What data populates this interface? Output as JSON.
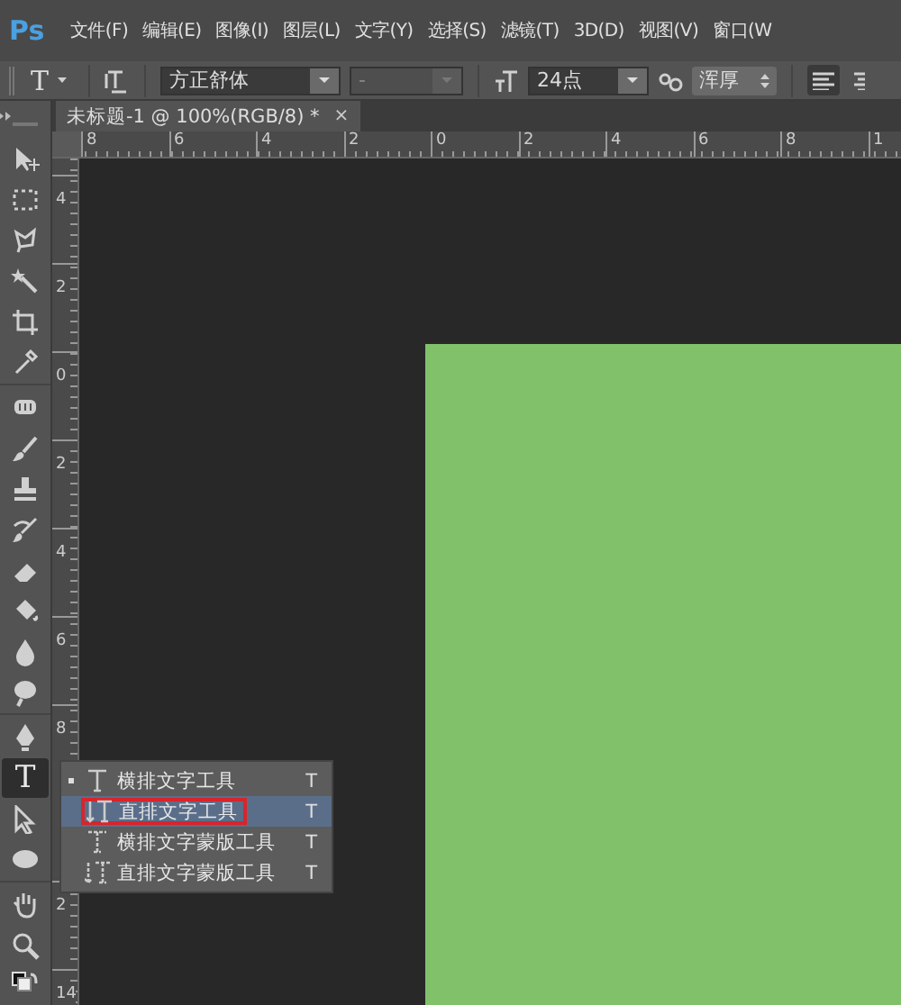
{
  "app": {
    "logo": "Ps"
  },
  "menu": [
    "文件(F)",
    "编辑(E)",
    "图像(I)",
    "图层(L)",
    "文字(Y)",
    "选择(S)",
    "滤镜(T)",
    "3D(D)",
    "视图(V)",
    "窗口(W"
  ],
  "options_bar": {
    "tool_icon": "T",
    "font_family": {
      "value": "方正舒体"
    },
    "font_style": {
      "value": "-",
      "disabled": true
    },
    "font_size": {
      "value": "24点"
    },
    "antialias": {
      "value": "浑厚"
    }
  },
  "document_tab": {
    "title": "未标题-1 @ 100%(RGB/8) *",
    "close": "×"
  },
  "ruler_h": [
    "8",
    "6",
    "4",
    "2",
    "0",
    "2",
    "4",
    "6",
    "8",
    "1"
  ],
  "ruler_v": [
    {
      "label": "4"
    },
    {
      "label": "2"
    },
    {
      "label": "0"
    },
    {
      "label": "2"
    },
    {
      "label": "4"
    },
    {
      "label": "6"
    },
    {
      "label": "8"
    },
    {
      "kind": "covered"
    },
    {
      "label": "2"
    },
    {
      "label": "14"
    }
  ],
  "tools": [
    {
      "kind": "move",
      "selected": false
    },
    {
      "kind": "marquee",
      "selected": false
    },
    {
      "kind": "lasso",
      "selected": false
    },
    {
      "kind": "wand",
      "selected": false
    },
    {
      "kind": "crop",
      "selected": false
    },
    {
      "kind": "eyedropper",
      "selected": false
    },
    {
      "kind": "healing",
      "selected": false
    },
    {
      "kind": "brush",
      "selected": false
    },
    {
      "kind": "stamp",
      "selected": false
    },
    {
      "kind": "history",
      "selected": false
    },
    {
      "kind": "eraser",
      "selected": false
    },
    {
      "kind": "bucket",
      "selected": false
    },
    {
      "kind": "blur",
      "selected": false
    },
    {
      "kind": "dodge",
      "selected": false
    },
    {
      "kind": "pen",
      "selected": false
    },
    {
      "kind": "type",
      "selected": true,
      "label": "T"
    },
    {
      "kind": "path",
      "selected": false
    },
    {
      "kind": "ellipse",
      "selected": false
    },
    {
      "kind": "hand",
      "selected": false
    },
    {
      "kind": "zoom",
      "selected": false
    },
    {
      "kind": "colors",
      "selected": false
    }
  ],
  "flyout": [
    {
      "label": "横排文字工具",
      "shortcut": "T",
      "kind": "horizontal",
      "current": true,
      "highlighted": false,
      "marked": false
    },
    {
      "label": "直排文字工具",
      "shortcut": "T",
      "kind": "vertical",
      "current": false,
      "highlighted": true,
      "marked": true
    },
    {
      "label": "横排文字蒙版工具",
      "shortcut": "T",
      "kind": "horizontal-mask",
      "current": false,
      "highlighted": false,
      "marked": false
    },
    {
      "label": "直排文字蒙版工具",
      "shortcut": "T",
      "kind": "vertical-mask",
      "current": false,
      "highlighted": false,
      "marked": false
    }
  ]
}
